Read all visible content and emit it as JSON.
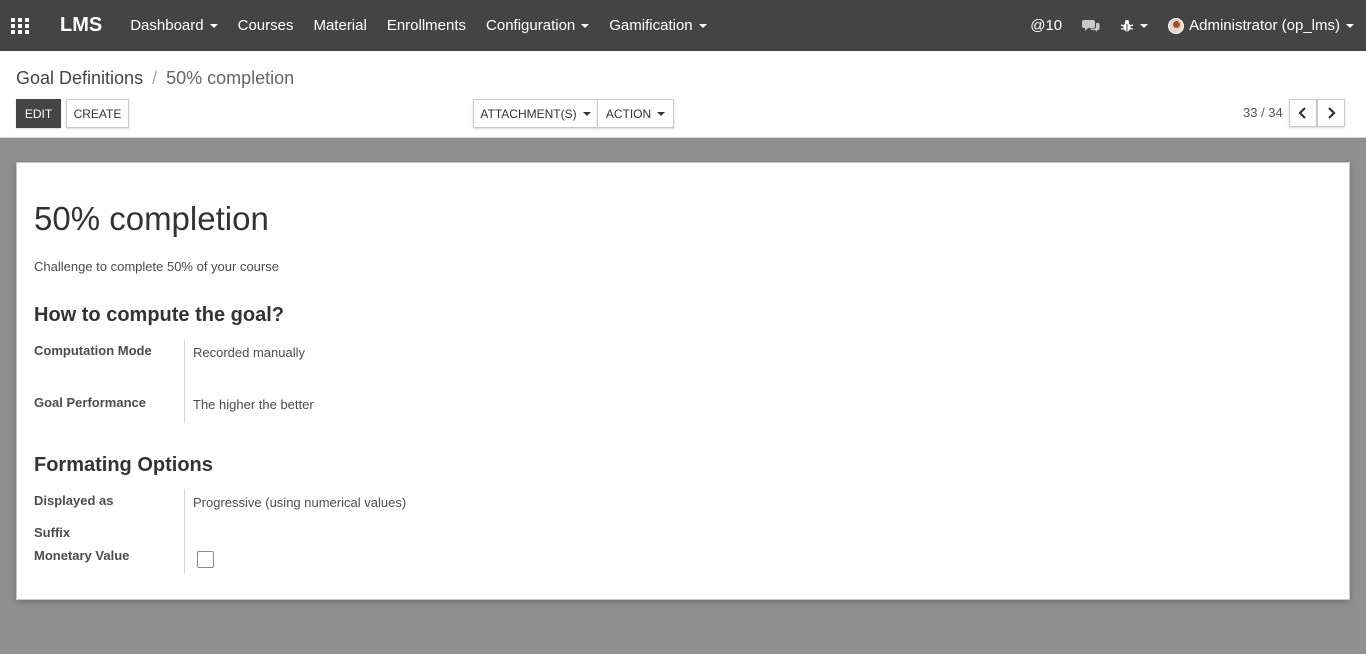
{
  "navbar": {
    "brand": "LMS",
    "menu": [
      {
        "label": "Dashboard",
        "dropdown": true
      },
      {
        "label": "Courses",
        "dropdown": false
      },
      {
        "label": "Material",
        "dropdown": false
      },
      {
        "label": "Enrollments",
        "dropdown": false
      },
      {
        "label": "Configuration",
        "dropdown": true
      },
      {
        "label": "Gamification",
        "dropdown": true
      }
    ],
    "mentions_count": "10",
    "mention_symbol": "@",
    "user": "Administrator (op_lms)"
  },
  "breadcrumb": {
    "parent": "Goal Definitions",
    "separator": "/",
    "current": "50% completion"
  },
  "buttons": {
    "edit": "EDIT",
    "create": "CREATE",
    "attachments": "ATTACHMENT(S)",
    "action": "ACTION"
  },
  "pager": {
    "value": "33 / 34"
  },
  "form": {
    "title": "50% completion",
    "description": "Challenge to complete 50% of your course",
    "section_compute": "How to compute the goal?",
    "computation_mode_label": "Computation Mode",
    "computation_mode_value": "Recorded manually",
    "goal_performance_label": "Goal Performance",
    "goal_performance_value": "The higher the better",
    "section_formatting": "Formating Options",
    "displayed_as_label": "Displayed as",
    "displayed_as_value": "Progressive (using numerical values)",
    "suffix_label": "Suffix",
    "monetary_label": "Monetary Value",
    "monetary_checked": false
  },
  "colors": {
    "navbar": "#444444",
    "primary_button": "#454545",
    "background": "#8f8f8f"
  }
}
